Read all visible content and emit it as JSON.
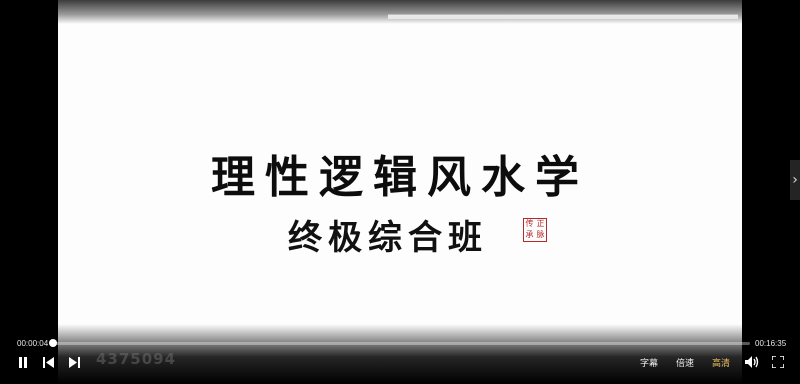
{
  "slide": {
    "title": "理性逻辑风水学",
    "subtitle": "终极综合班",
    "seal_chars": [
      "传",
      "正",
      "承",
      "脉"
    ]
  },
  "watermark": "4375094",
  "player": {
    "current_time": "00:00:04",
    "total_time": "00:16:35",
    "progress_fraction": 0.004,
    "subtitle_label": "字幕",
    "speed_label": "倍速",
    "quality_label": "高清",
    "quality_color": "#f0c060",
    "icons": [
      "pause-icon",
      "previous-icon",
      "next-icon",
      "volume-icon",
      "fullscreen-icon",
      "chevron-right-icon"
    ]
  }
}
